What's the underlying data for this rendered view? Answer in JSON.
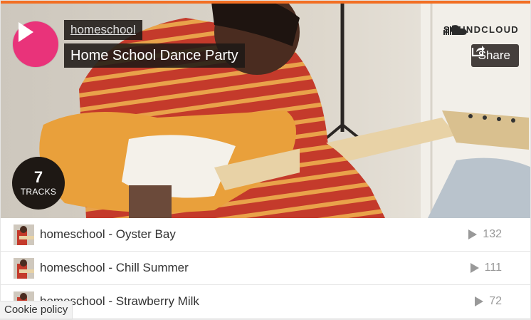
{
  "brand": {
    "name": "SOUNDCLOUD",
    "accent": "#f26f23",
    "play_color": "#e9337a"
  },
  "header": {
    "user": "homeschool",
    "title": "Home School Dance Party",
    "share_label": "Share"
  },
  "badge": {
    "count": "7",
    "label": "TRACKS"
  },
  "tracks": [
    {
      "title": "homeschool - Oyster Bay",
      "plays": "132"
    },
    {
      "title": "homeschool - Chill Summer",
      "plays": "111"
    },
    {
      "title": "homeschool - Strawberry Milk",
      "plays": "72"
    }
  ],
  "footer": {
    "cookie_label": "Cookie policy"
  }
}
